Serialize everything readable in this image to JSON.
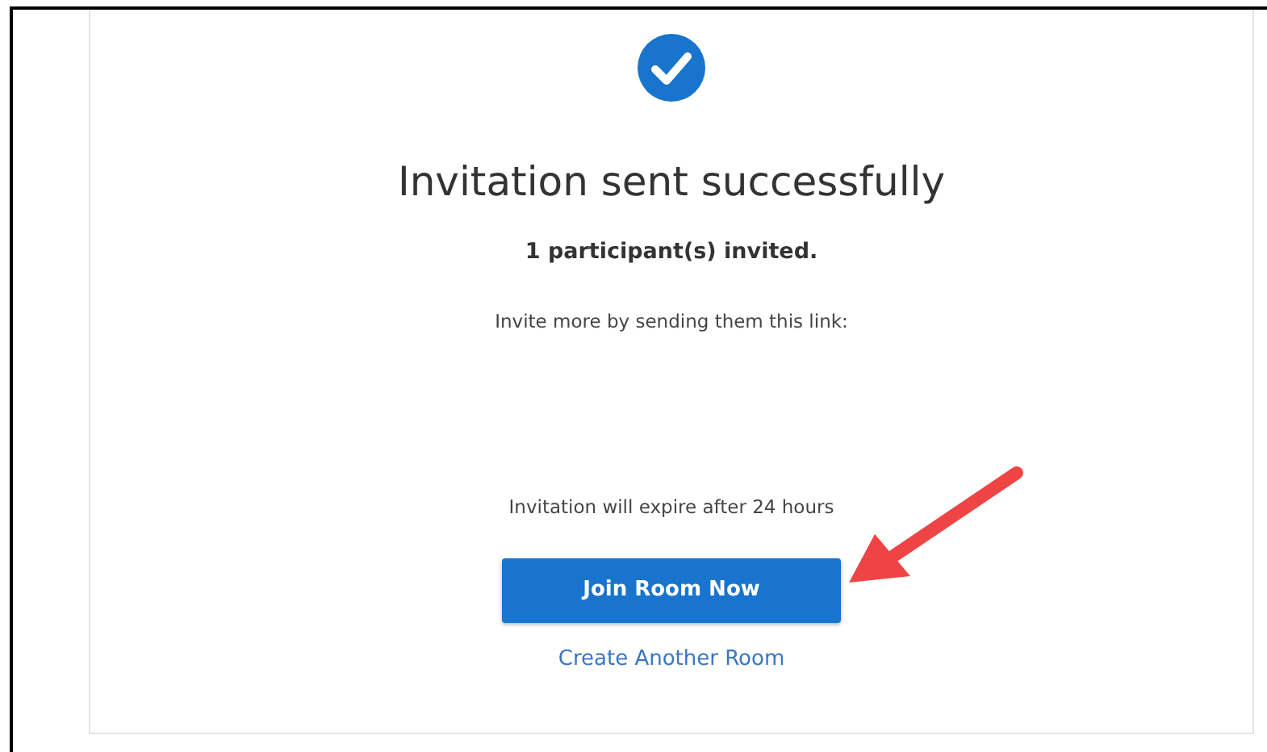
{
  "dialog": {
    "title": "Invitation sent successfully",
    "summary": "1 participant(s) invited.",
    "invite_hint": "Invite more by sending them this link:",
    "expiry_note": "Invitation will expire after 24 hours",
    "primary_button": "Join Room Now",
    "secondary_link": "Create Another Room"
  }
}
